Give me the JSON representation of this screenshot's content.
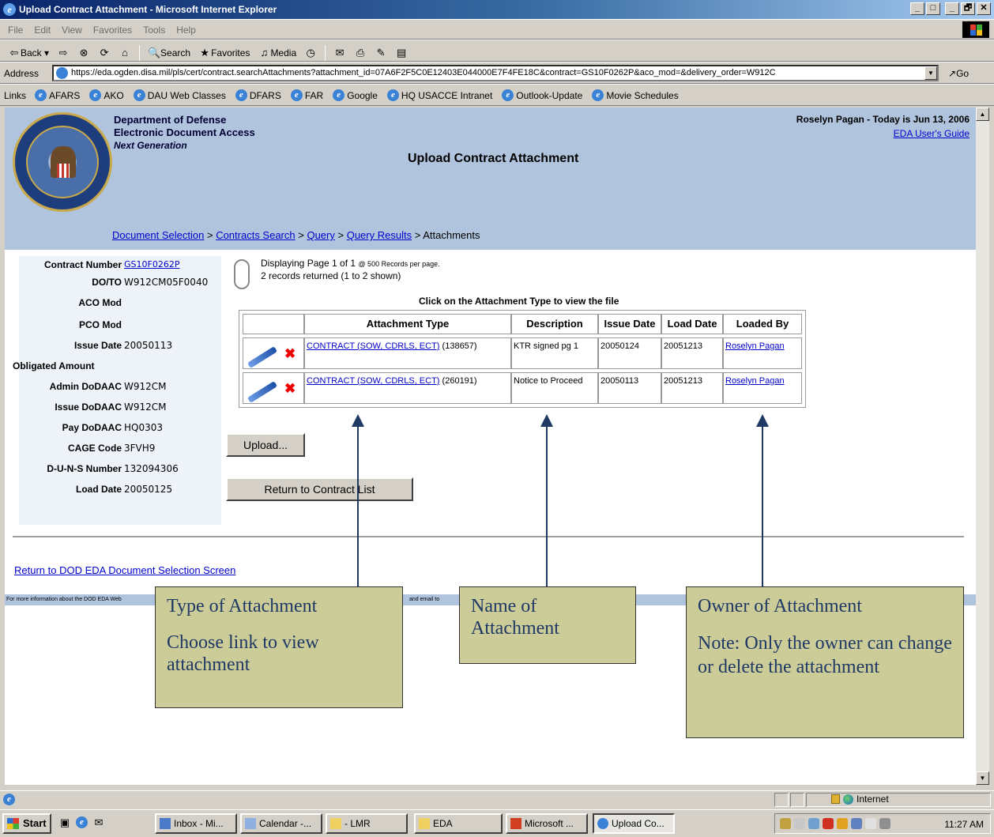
{
  "window": {
    "title": "Upload Contract Attachment - Microsoft Internet Explorer",
    "controls": [
      "_",
      "□",
      "_",
      "🗗",
      "✕"
    ]
  },
  "menubar": {
    "items": [
      "File",
      "Edit",
      "View",
      "Favorites",
      "Tools",
      "Help"
    ]
  },
  "toolbar": {
    "back": "Back",
    "search": "Search",
    "favorites": "Favorites",
    "media": "Media"
  },
  "address": {
    "label": "Address",
    "url": "https://eda.ogden.disa.mil/pls/cert/contract.searchAttachments?attachment_id=07A6F2F5C0E12403E044000E7F4FE18C&contract=GS10F0262P&aco_mod=&delivery_order=W912C",
    "go": "Go"
  },
  "links": {
    "label": "Links",
    "items": [
      "AFARS",
      "AKO",
      "DAU Web Classes",
      "DFARS",
      "FAR",
      "Google",
      "HQ USACCE Intranet",
      "Outlook-Update",
      "Movie Schedules"
    ]
  },
  "header": {
    "org_line1": "Department of Defense",
    "org_line2": "Electronic Document Access",
    "org_line3": "Next Generation",
    "page_title": "Upload Contract Attachment",
    "user_line": "Roselyn Pagan - Today is Jun 13, 2006",
    "guide_link": "EDA User's Guide"
  },
  "breadcrumb": {
    "items": [
      "Document Selection",
      "Contracts Search",
      "Query",
      "Query Results"
    ],
    "current": "Attachments",
    "separator": ">"
  },
  "contract": {
    "rows": [
      {
        "label": "Contract Number",
        "value": "GS10F0262P"
      },
      {
        "label": "DO/TO",
        "value": "W912CM05F0040"
      },
      {
        "label": "ACO Mod",
        "value": ""
      },
      {
        "label": "PCO Mod",
        "value": ""
      },
      {
        "label": "Issue Date",
        "value": "20050113"
      },
      {
        "label": "Obligated Amount",
        "value": ""
      },
      {
        "label": "Admin DoDAAC",
        "value": "W912CM"
      },
      {
        "label": "Issue DoDAAC",
        "value": "W912CM"
      },
      {
        "label": "Pay DoDAAC",
        "value": "HQ0303"
      },
      {
        "label": "CAGE Code",
        "value": "3FVH9"
      },
      {
        "label": "D-U-N-S Number",
        "value": "132094306"
      },
      {
        "label": "Load Date",
        "value": "20050125"
      }
    ]
  },
  "paging": {
    "line1": "Displaying Page 1 of 1",
    "per_page": "@ 500 Records per page.",
    "line2": "2 records returned (1 to 2 shown)"
  },
  "table": {
    "hint": "Click on the Attachment Type to view the file",
    "headers": [
      "Attachment Type",
      "Description",
      "Issue Date",
      "Load Date",
      "Loaded By"
    ],
    "rows": [
      {
        "type": "CONTRACT (SOW, CDRLS, ECT)",
        "size": "(138657)",
        "description": "KTR signed pg 1",
        "issue_date": "20050124",
        "load_date": "20051213",
        "loaded_by": "Roselyn Pagan"
      },
      {
        "type": "CONTRACT (SOW, CDRLS, ECT)",
        "size": "(260191)",
        "description": "Notice to Proceed",
        "issue_date": "20050113",
        "load_date": "20051213",
        "loaded_by": "Roselyn Pagan"
      }
    ]
  },
  "buttons": {
    "upload": "Upload...",
    "return_contract": "Return to Contract List"
  },
  "return_link": "Return to DOD EDA Document Selection Screen",
  "footer": {
    "left": "For more information about the DOD EDA Web",
    "mid": "and email to"
  },
  "callouts": {
    "type": {
      "line1": "Type of Attachment",
      "line2": "Choose link to view attachment"
    },
    "name": {
      "line1": "Name of Attachment"
    },
    "owner": {
      "line1": "Owner of Attachment",
      "line2": "Note: Only the owner can change or delete the attachment"
    }
  },
  "statusbar": {
    "zone": "Internet"
  },
  "taskbar": {
    "start": "Start",
    "tasks": [
      "Inbox - Mi...",
      "Calendar -...",
      "- LMR",
      "EDA",
      "Microsoft ...",
      "Upload Co..."
    ],
    "clock": "11:27 AM"
  },
  "colors": {
    "header_bg": "#b0c4de",
    "callout_bg": "#cccc99",
    "callout_text": "#1f3864",
    "link": "#0000cc",
    "delete": "#ee0000"
  }
}
